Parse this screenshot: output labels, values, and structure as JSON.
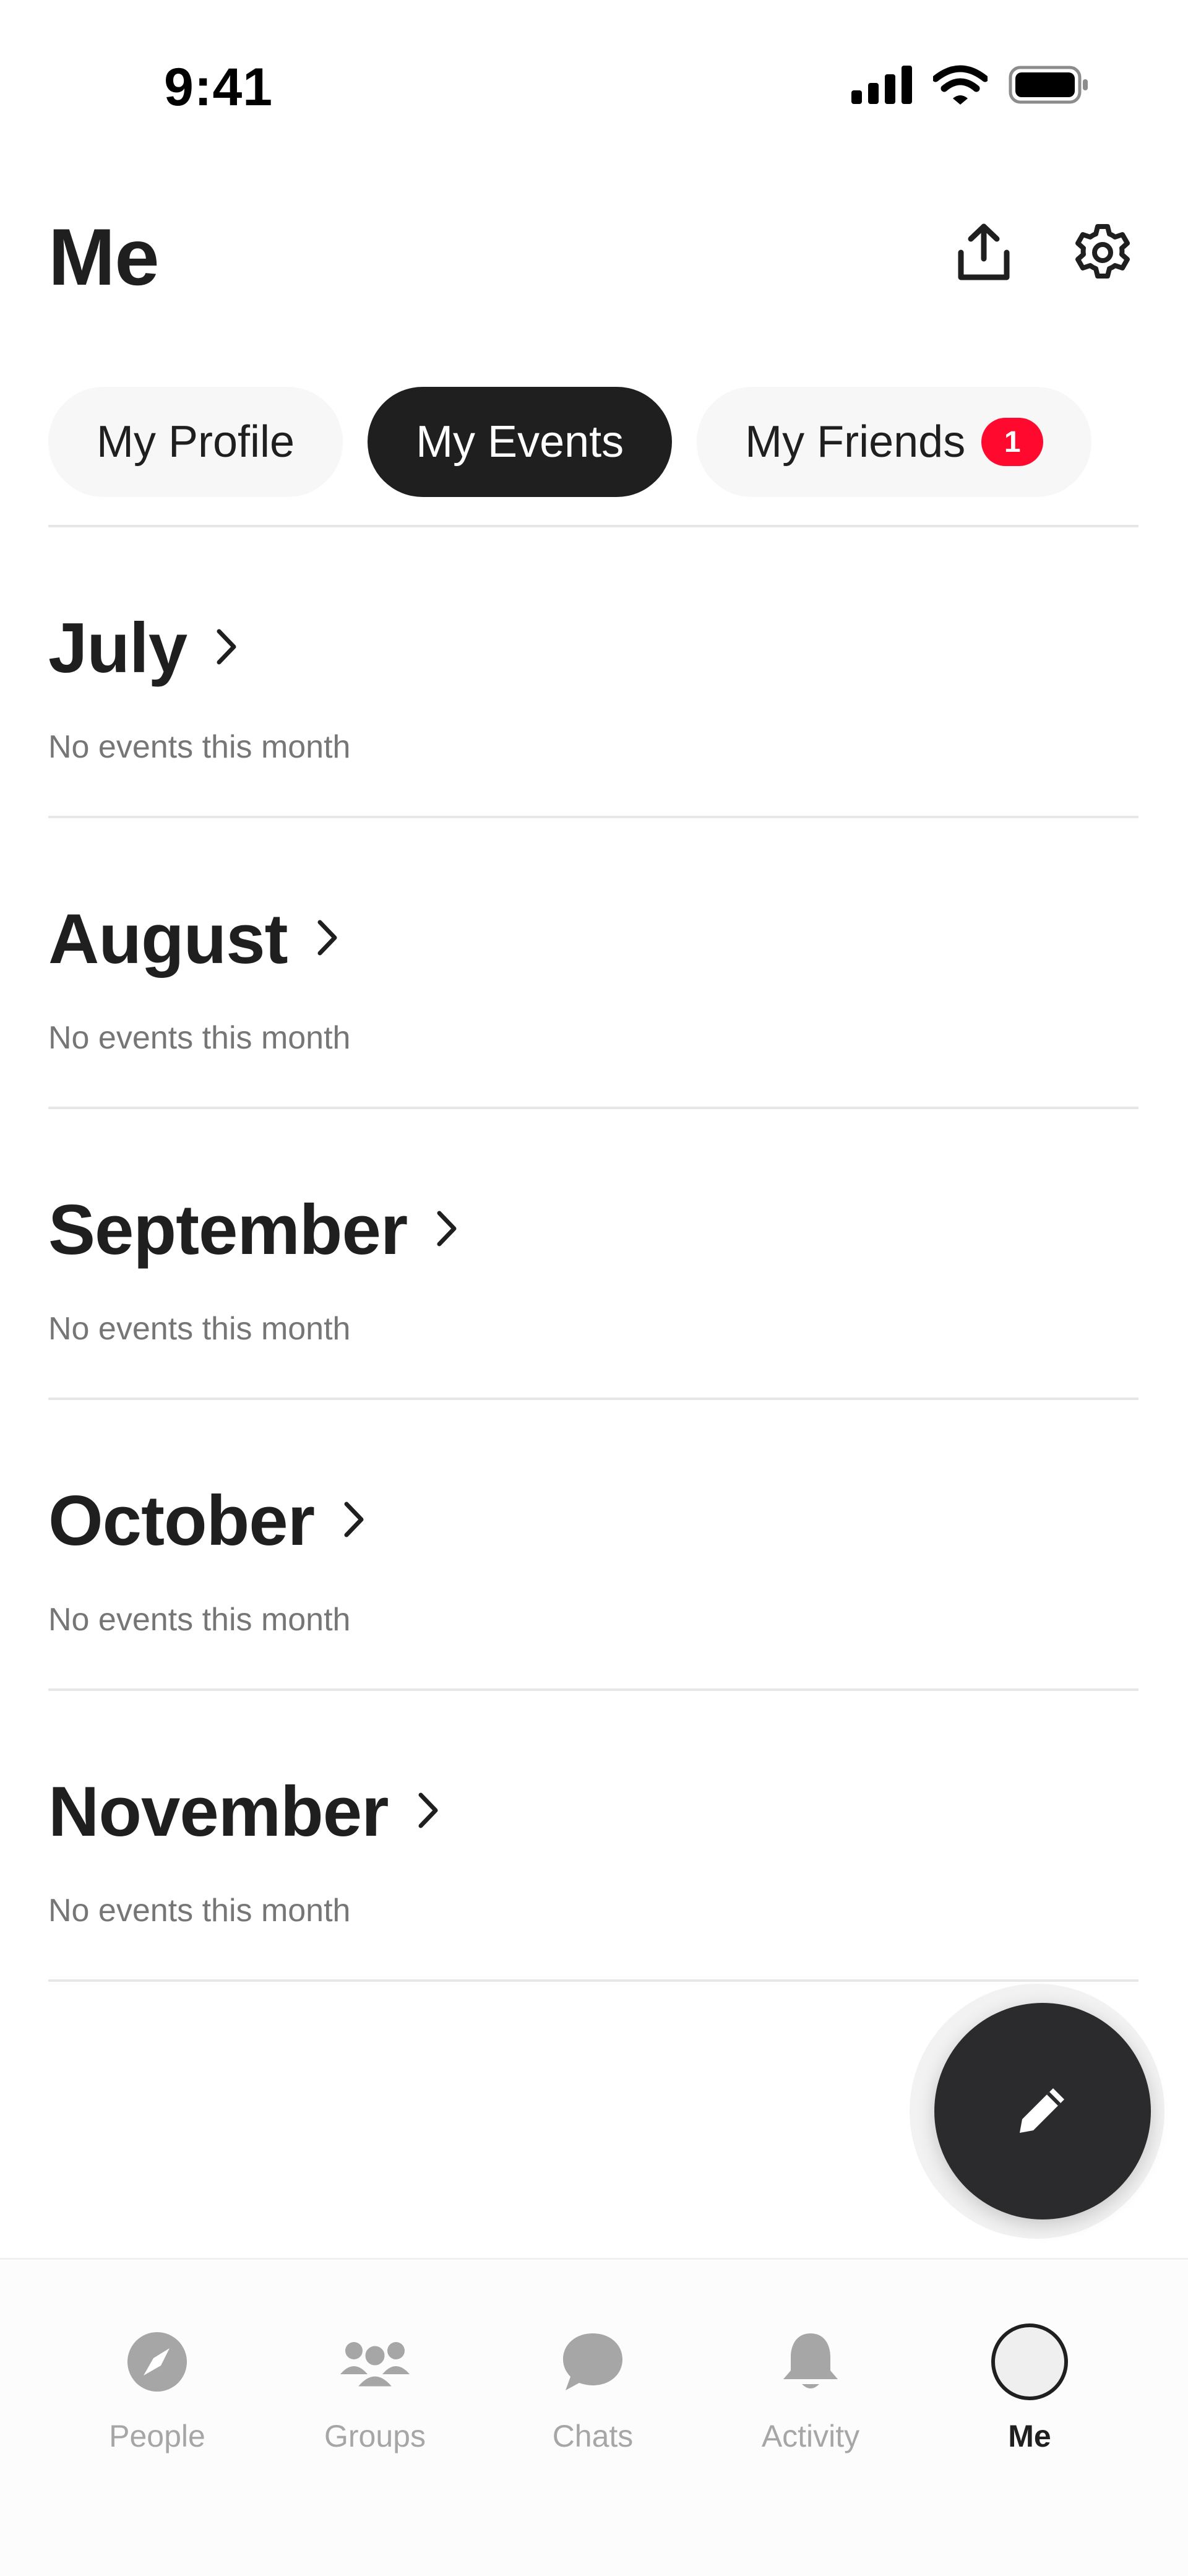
{
  "status_bar": {
    "time": "9:41",
    "icons": [
      "signal-icon",
      "wifi-icon",
      "battery-icon"
    ]
  },
  "header": {
    "title": "Me",
    "actions": [
      "share-icon",
      "gear-icon"
    ]
  },
  "tabs": [
    {
      "label": "My Profile",
      "active": false
    },
    {
      "label": "My Events",
      "active": true
    },
    {
      "label": "My Friends",
      "active": false,
      "badge": "1"
    }
  ],
  "months": [
    {
      "name": "July",
      "empty_text": "No events this month"
    },
    {
      "name": "August",
      "empty_text": "No events this month"
    },
    {
      "name": "September",
      "empty_text": "No events this month"
    },
    {
      "name": "October",
      "empty_text": "No events this month"
    },
    {
      "name": "November",
      "empty_text": "No events this month"
    }
  ],
  "fab": {
    "icon": "pencil-icon"
  },
  "bottom_nav": [
    {
      "label": "People",
      "icon": "compass-icon",
      "active": false
    },
    {
      "label": "Groups",
      "icon": "people-group-icon",
      "active": false
    },
    {
      "label": "Chats",
      "icon": "chat-bubble-icon",
      "active": false
    },
    {
      "label": "Activity",
      "icon": "bell-icon",
      "active": false
    },
    {
      "label": "Me",
      "icon": "avatar",
      "active": true
    }
  ],
  "colors": {
    "text": "#1f1f1f",
    "muted": "#767676",
    "tab_bg": "#f6f7f6",
    "active_tab_bg": "#1f1f1f",
    "badge": "#ff0a2e",
    "fab_bg": "#2b2b2e",
    "nav_inactive": "#a6a6a6"
  }
}
